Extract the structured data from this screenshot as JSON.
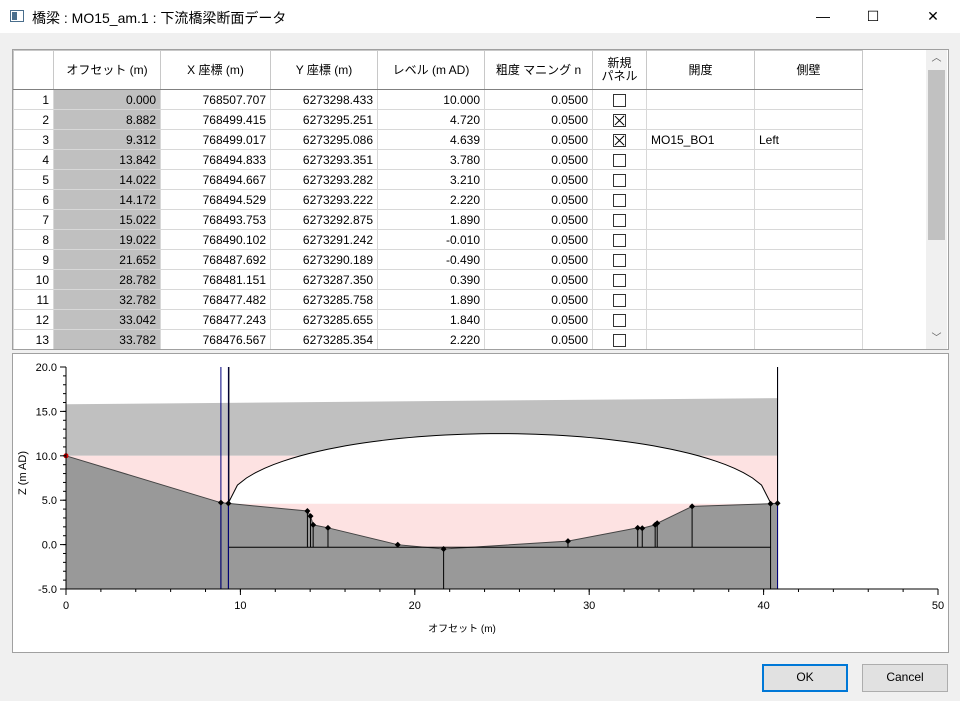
{
  "window": {
    "title": "橋梁 : MO15_am.1 : 下流橋梁断面データ",
    "minimize_glyph": "—",
    "maximize_glyph": "☐",
    "close_glyph": "✕"
  },
  "table": {
    "columns": [
      "",
      "オフセット (m)",
      "X 座標 (m)",
      "Y 座標 (m)",
      "レベル (m AD)",
      "粗度 マニング n",
      "新規\nパネル",
      "開度",
      "側壁"
    ],
    "rows": [
      {
        "n": "1",
        "offset": "0.000",
        "x": "768507.707",
        "y": "6273298.433",
        "level": "10.000",
        "n_val": "0.0500",
        "panel": false,
        "opening": "",
        "wall": ""
      },
      {
        "n": "2",
        "offset": "8.882",
        "x": "768499.415",
        "y": "6273295.251",
        "level": "4.720",
        "n_val": "0.0500",
        "panel": true,
        "opening": "",
        "wall": ""
      },
      {
        "n": "3",
        "offset": "9.312",
        "x": "768499.017",
        "y": "6273295.086",
        "level": "4.639",
        "n_val": "0.0500",
        "panel": true,
        "opening": "MO15_BO1",
        "wall": "Left"
      },
      {
        "n": "4",
        "offset": "13.842",
        "x": "768494.833",
        "y": "6273293.351",
        "level": "3.780",
        "n_val": "0.0500",
        "panel": false,
        "opening": "",
        "wall": ""
      },
      {
        "n": "5",
        "offset": "14.022",
        "x": "768494.667",
        "y": "6273293.282",
        "level": "3.210",
        "n_val": "0.0500",
        "panel": false,
        "opening": "",
        "wall": ""
      },
      {
        "n": "6",
        "offset": "14.172",
        "x": "768494.529",
        "y": "6273293.222",
        "level": "2.220",
        "n_val": "0.0500",
        "panel": false,
        "opening": "",
        "wall": ""
      },
      {
        "n": "7",
        "offset": "15.022",
        "x": "768493.753",
        "y": "6273292.875",
        "level": "1.890",
        "n_val": "0.0500",
        "panel": false,
        "opening": "",
        "wall": ""
      },
      {
        "n": "8",
        "offset": "19.022",
        "x": "768490.102",
        "y": "6273291.242",
        "level": "-0.010",
        "n_val": "0.0500",
        "panel": false,
        "opening": "",
        "wall": ""
      },
      {
        "n": "9",
        "offset": "21.652",
        "x": "768487.692",
        "y": "6273290.189",
        "level": "-0.490",
        "n_val": "0.0500",
        "panel": false,
        "opening": "",
        "wall": ""
      },
      {
        "n": "10",
        "offset": "28.782",
        "x": "768481.151",
        "y": "6273287.350",
        "level": "0.390",
        "n_val": "0.0500",
        "panel": false,
        "opening": "",
        "wall": ""
      },
      {
        "n": "11",
        "offset": "32.782",
        "x": "768477.482",
        "y": "6273285.758",
        "level": "1.890",
        "n_val": "0.0500",
        "panel": false,
        "opening": "",
        "wall": ""
      },
      {
        "n": "12",
        "offset": "33.042",
        "x": "768477.243",
        "y": "6273285.655",
        "level": "1.840",
        "n_val": "0.0500",
        "panel": false,
        "opening": "",
        "wall": ""
      },
      {
        "n": "13",
        "offset": "33.782",
        "x": "768476.567",
        "y": "6273285.354",
        "level": "2.220",
        "n_val": "0.0500",
        "panel": false,
        "opening": "",
        "wall": ""
      }
    ]
  },
  "plot": {
    "xlabel": "オフセット (m)",
    "ylabel": "Z (m AD)",
    "xlim": [
      0,
      50
    ],
    "ylim": [
      -5,
      20
    ],
    "xticks": [
      "0",
      "10",
      "20",
      "30",
      "40",
      "50"
    ],
    "yticks": [
      "-5.0",
      "0.0",
      "5.0",
      "10.0",
      "15.0",
      "20.0"
    ],
    "colors": {
      "ground": "#999999",
      "deck": "#c0c0c0",
      "pink": "#fde2e2",
      "opening_line": "#000080"
    }
  },
  "chart_data": {
    "type": "area",
    "xlabel": "オフセット (m)",
    "ylabel": "Z (m AD)",
    "xlim": [
      0,
      50
    ],
    "ylim": [
      -5,
      20
    ],
    "ground_profile": [
      [
        0.0,
        10.0
      ],
      [
        8.882,
        4.72
      ],
      [
        9.312,
        4.639
      ],
      [
        13.842,
        3.78
      ],
      [
        14.022,
        3.21
      ],
      [
        14.172,
        2.22
      ],
      [
        15.022,
        1.89
      ],
      [
        19.022,
        -0.01
      ],
      [
        21.652,
        -0.49
      ],
      [
        28.782,
        0.39
      ],
      [
        32.782,
        1.89
      ],
      [
        33.042,
        1.84
      ],
      [
        33.782,
        2.22
      ],
      [
        33.9,
        2.4
      ],
      [
        35.9,
        4.3
      ],
      [
        40.4,
        4.6
      ],
      [
        40.8,
        4.65
      ]
    ],
    "deck_top": [
      [
        0,
        15.8
      ],
      [
        40.8,
        16.5
      ]
    ],
    "deck_soffit": 10.0,
    "arch_crown": 12.5,
    "arch_span": [
      9.312,
      40.4
    ],
    "opening_verticals": [
      8.882,
      9.312,
      40.8
    ],
    "bottom_line": {
      "level": -0.3,
      "from": 9.312,
      "to": 40.4
    }
  },
  "buttons": {
    "ok": "OK",
    "cancel": "Cancel"
  }
}
